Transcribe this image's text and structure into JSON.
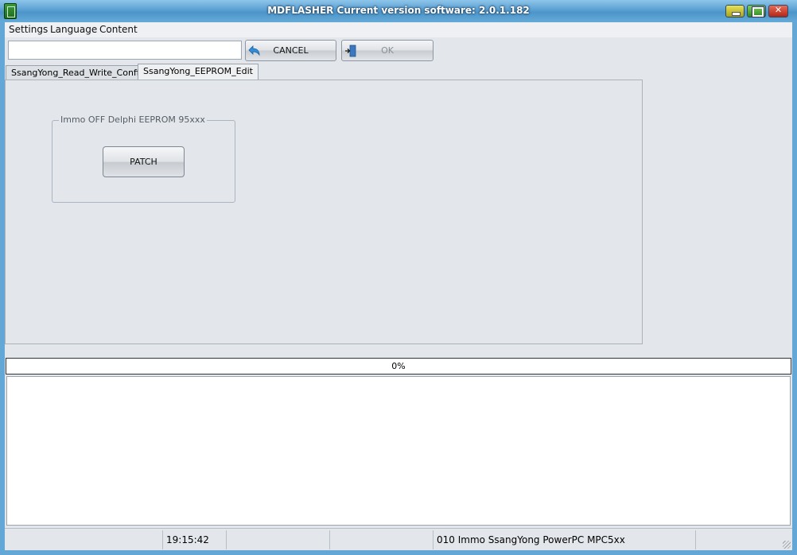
{
  "window": {
    "title": "MDFLASHER  Current version software: 2.0.1.182",
    "app_icon": "chip-icon",
    "controls": {
      "minimize": "minimize-icon",
      "maximize": "maximize-icon",
      "close": "close-icon",
      "close_glyph": "✕"
    }
  },
  "menubar": {
    "items": [
      "Settings",
      "Language",
      "Content"
    ]
  },
  "toolbar": {
    "path_value": "",
    "cancel_label": "CANCEL",
    "cancel_icon": "undo-arrow-icon",
    "ok_label": "OK",
    "ok_icon": "door-enter-icon",
    "ok_enabled": false
  },
  "tabs": [
    {
      "label": "SsangYong_Read_Write_Config",
      "active": false
    },
    {
      "label": "SsangYong_EEPROM_Edit",
      "active": true
    }
  ],
  "panel": {
    "group_caption": "Immo OFF  Delphi EEPROM 95xxx",
    "patch_label": "PATCH"
  },
  "progress": {
    "text": "0%",
    "value": 0
  },
  "log": {
    "lines": []
  },
  "statusbar": {
    "time": "19:15:42",
    "module": "010 Immo SsangYong PowerPC MPC5xx"
  },
  "colors": {
    "titlebar": "#62a7d6",
    "client_bg": "#e3e6ea",
    "accent_blue": "#3a8ee6"
  }
}
